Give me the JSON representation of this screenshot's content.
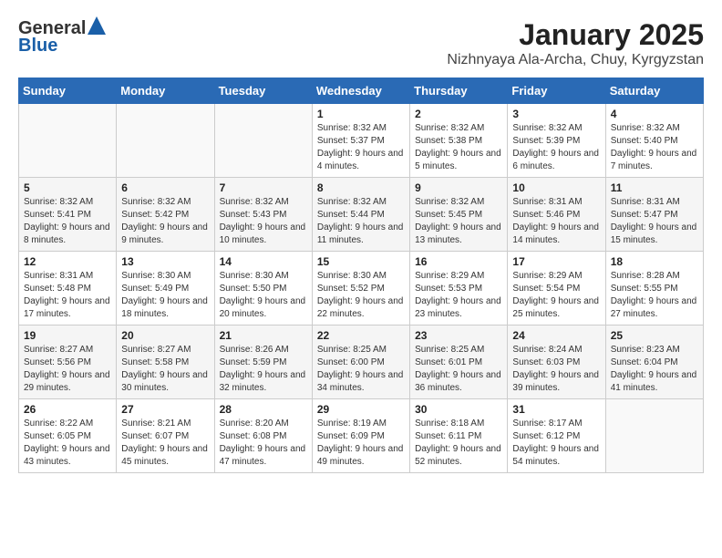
{
  "header": {
    "logo_line1": "General",
    "logo_line2": "Blue",
    "title": "January 2025",
    "subtitle": "Nizhnyaya Ala-Archa, Chuy, Kyrgyzstan"
  },
  "days_of_week": [
    "Sunday",
    "Monday",
    "Tuesday",
    "Wednesday",
    "Thursday",
    "Friday",
    "Saturday"
  ],
  "weeks": [
    [
      {
        "day": "",
        "info": ""
      },
      {
        "day": "",
        "info": ""
      },
      {
        "day": "",
        "info": ""
      },
      {
        "day": "1",
        "info": "Sunrise: 8:32 AM\nSunset: 5:37 PM\nDaylight: 9 hours and 4 minutes."
      },
      {
        "day": "2",
        "info": "Sunrise: 8:32 AM\nSunset: 5:38 PM\nDaylight: 9 hours and 5 minutes."
      },
      {
        "day": "3",
        "info": "Sunrise: 8:32 AM\nSunset: 5:39 PM\nDaylight: 9 hours and 6 minutes."
      },
      {
        "day": "4",
        "info": "Sunrise: 8:32 AM\nSunset: 5:40 PM\nDaylight: 9 hours and 7 minutes."
      }
    ],
    [
      {
        "day": "5",
        "info": "Sunrise: 8:32 AM\nSunset: 5:41 PM\nDaylight: 9 hours and 8 minutes."
      },
      {
        "day": "6",
        "info": "Sunrise: 8:32 AM\nSunset: 5:42 PM\nDaylight: 9 hours and 9 minutes."
      },
      {
        "day": "7",
        "info": "Sunrise: 8:32 AM\nSunset: 5:43 PM\nDaylight: 9 hours and 10 minutes."
      },
      {
        "day": "8",
        "info": "Sunrise: 8:32 AM\nSunset: 5:44 PM\nDaylight: 9 hours and 11 minutes."
      },
      {
        "day": "9",
        "info": "Sunrise: 8:32 AM\nSunset: 5:45 PM\nDaylight: 9 hours and 13 minutes."
      },
      {
        "day": "10",
        "info": "Sunrise: 8:31 AM\nSunset: 5:46 PM\nDaylight: 9 hours and 14 minutes."
      },
      {
        "day": "11",
        "info": "Sunrise: 8:31 AM\nSunset: 5:47 PM\nDaylight: 9 hours and 15 minutes."
      }
    ],
    [
      {
        "day": "12",
        "info": "Sunrise: 8:31 AM\nSunset: 5:48 PM\nDaylight: 9 hours and 17 minutes."
      },
      {
        "day": "13",
        "info": "Sunrise: 8:30 AM\nSunset: 5:49 PM\nDaylight: 9 hours and 18 minutes."
      },
      {
        "day": "14",
        "info": "Sunrise: 8:30 AM\nSunset: 5:50 PM\nDaylight: 9 hours and 20 minutes."
      },
      {
        "day": "15",
        "info": "Sunrise: 8:30 AM\nSunset: 5:52 PM\nDaylight: 9 hours and 22 minutes."
      },
      {
        "day": "16",
        "info": "Sunrise: 8:29 AM\nSunset: 5:53 PM\nDaylight: 9 hours and 23 minutes."
      },
      {
        "day": "17",
        "info": "Sunrise: 8:29 AM\nSunset: 5:54 PM\nDaylight: 9 hours and 25 minutes."
      },
      {
        "day": "18",
        "info": "Sunrise: 8:28 AM\nSunset: 5:55 PM\nDaylight: 9 hours and 27 minutes."
      }
    ],
    [
      {
        "day": "19",
        "info": "Sunrise: 8:27 AM\nSunset: 5:56 PM\nDaylight: 9 hours and 29 minutes."
      },
      {
        "day": "20",
        "info": "Sunrise: 8:27 AM\nSunset: 5:58 PM\nDaylight: 9 hours and 30 minutes."
      },
      {
        "day": "21",
        "info": "Sunrise: 8:26 AM\nSunset: 5:59 PM\nDaylight: 9 hours and 32 minutes."
      },
      {
        "day": "22",
        "info": "Sunrise: 8:25 AM\nSunset: 6:00 PM\nDaylight: 9 hours and 34 minutes."
      },
      {
        "day": "23",
        "info": "Sunrise: 8:25 AM\nSunset: 6:01 PM\nDaylight: 9 hours and 36 minutes."
      },
      {
        "day": "24",
        "info": "Sunrise: 8:24 AM\nSunset: 6:03 PM\nDaylight: 9 hours and 39 minutes."
      },
      {
        "day": "25",
        "info": "Sunrise: 8:23 AM\nSunset: 6:04 PM\nDaylight: 9 hours and 41 minutes."
      }
    ],
    [
      {
        "day": "26",
        "info": "Sunrise: 8:22 AM\nSunset: 6:05 PM\nDaylight: 9 hours and 43 minutes."
      },
      {
        "day": "27",
        "info": "Sunrise: 8:21 AM\nSunset: 6:07 PM\nDaylight: 9 hours and 45 minutes."
      },
      {
        "day": "28",
        "info": "Sunrise: 8:20 AM\nSunset: 6:08 PM\nDaylight: 9 hours and 47 minutes."
      },
      {
        "day": "29",
        "info": "Sunrise: 8:19 AM\nSunset: 6:09 PM\nDaylight: 9 hours and 49 minutes."
      },
      {
        "day": "30",
        "info": "Sunrise: 8:18 AM\nSunset: 6:11 PM\nDaylight: 9 hours and 52 minutes."
      },
      {
        "day": "31",
        "info": "Sunrise: 8:17 AM\nSunset: 6:12 PM\nDaylight: 9 hours and 54 minutes."
      },
      {
        "day": "",
        "info": ""
      }
    ]
  ]
}
